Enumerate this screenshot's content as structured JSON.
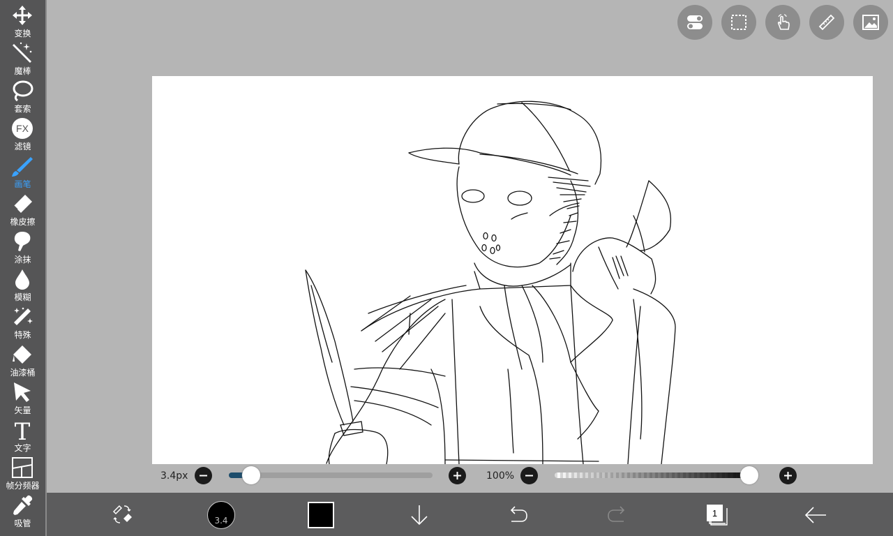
{
  "sidebar": {
    "tools": [
      {
        "label": "变换",
        "icon": "move-arrows-icon",
        "active": false
      },
      {
        "label": "魔棒",
        "icon": "magic-wand-icon",
        "active": false
      },
      {
        "label": "套索",
        "icon": "lasso-icon",
        "active": false
      },
      {
        "label": "滤镜",
        "icon": "fx-icon",
        "active": false
      },
      {
        "label": "画笔",
        "icon": "brush-icon",
        "active": true
      },
      {
        "label": "橡皮擦",
        "icon": "eraser-icon",
        "active": false
      },
      {
        "label": "涂抹",
        "icon": "smudge-icon",
        "active": false
      },
      {
        "label": "模糊",
        "icon": "blur-drop-icon",
        "active": false
      },
      {
        "label": "特殊",
        "icon": "special-wand-icon",
        "active": false
      },
      {
        "label": "油漆桶",
        "icon": "paint-bucket-icon",
        "active": false
      },
      {
        "label": "矢量",
        "icon": "vector-arrow-icon",
        "active": false
      },
      {
        "label": "文字",
        "icon": "text-t-icon",
        "active": false
      },
      {
        "label": "帧分频器",
        "icon": "frame-divider-icon",
        "active": false
      },
      {
        "label": "吸管",
        "icon": "eyedropper-icon",
        "active": false
      }
    ],
    "fx_text": "FX",
    "text_tool_glyph": "T",
    "active_color": "#3aa2ff"
  },
  "top_buttons": [
    {
      "icon": "toggle-switch-icon"
    },
    {
      "icon": "selection-marquee-icon"
    },
    {
      "icon": "hand-touch-icon"
    },
    {
      "icon": "ruler-icon"
    },
    {
      "icon": "image-icon"
    }
  ],
  "sliders": {
    "brush_size_label": "3.4px",
    "brush_size_fraction": 0.11,
    "opacity_label": "100%",
    "opacity_fraction": 1.0
  },
  "bottom_bar": {
    "brush_size_text": "3.4",
    "current_color": "#000000",
    "layer_count": "1",
    "icons": [
      "swap-tool-icon",
      "brush-size-circle",
      "color-swatch",
      "download-arrow-icon",
      "undo-icon",
      "redo-icon",
      "layers-icon",
      "back-arrow-icon"
    ]
  }
}
